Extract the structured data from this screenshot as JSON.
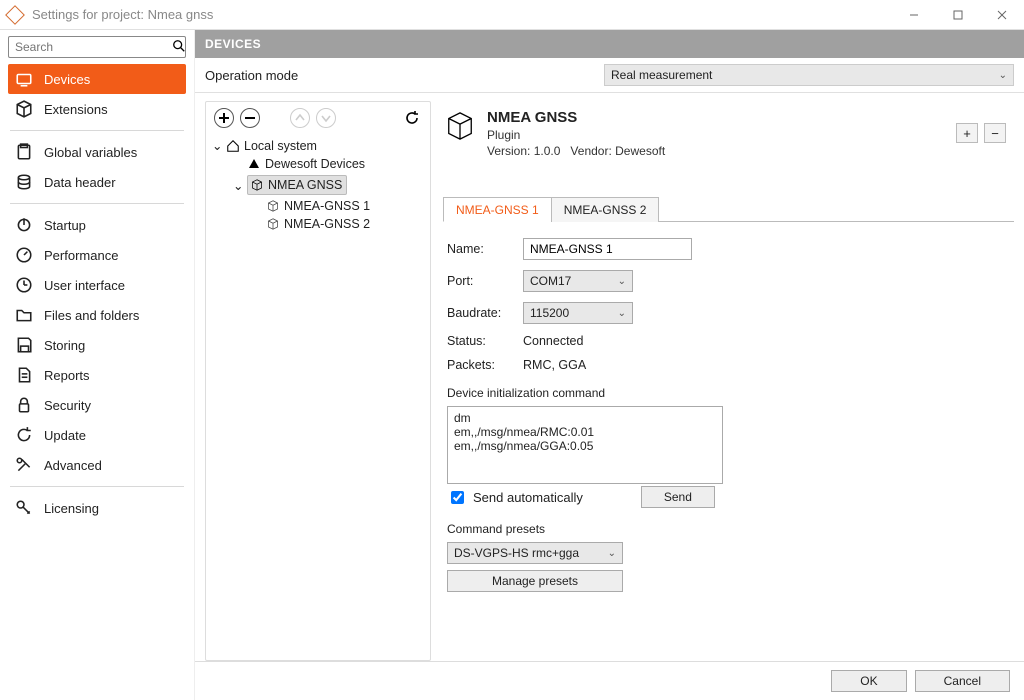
{
  "window": {
    "title": "Settings for project: Nmea gnss"
  },
  "search": {
    "placeholder": "Search"
  },
  "sidebar": {
    "groups": [
      {
        "items": [
          {
            "id": "devices",
            "label": "Devices",
            "icon": "devices",
            "active": true
          },
          {
            "id": "extensions",
            "label": "Extensions",
            "icon": "cube"
          }
        ]
      },
      {
        "items": [
          {
            "id": "global-vars",
            "label": "Global variables",
            "icon": "clipboard"
          },
          {
            "id": "data-header",
            "label": "Data header",
            "icon": "database"
          }
        ]
      },
      {
        "items": [
          {
            "id": "startup",
            "label": "Startup",
            "icon": "power"
          },
          {
            "id": "performance",
            "label": "Performance",
            "icon": "gauge"
          },
          {
            "id": "ui",
            "label": "User interface",
            "icon": "clock"
          },
          {
            "id": "files",
            "label": "Files and folders",
            "icon": "folder"
          },
          {
            "id": "storing",
            "label": "Storing",
            "icon": "save"
          },
          {
            "id": "reports",
            "label": "Reports",
            "icon": "document"
          },
          {
            "id": "security",
            "label": "Security",
            "icon": "lock"
          },
          {
            "id": "update",
            "label": "Update",
            "icon": "refresh"
          },
          {
            "id": "advanced",
            "label": "Advanced",
            "icon": "tools"
          }
        ]
      },
      {
        "items": [
          {
            "id": "licensing",
            "label": "Licensing",
            "icon": "key"
          }
        ]
      }
    ]
  },
  "section_header": "DEVICES",
  "operation_mode": {
    "label": "Operation mode",
    "value": "Real measurement"
  },
  "tree": {
    "root": {
      "label": "Local system",
      "children": [
        {
          "id": "dewesoft-devices",
          "label": "Dewesoft Devices",
          "icon": "triangle"
        },
        {
          "id": "nmea-gnss",
          "label": "NMEA GNSS",
          "icon": "cube",
          "selected": true,
          "children": [
            {
              "id": "nmea1",
              "label": "NMEA-GNSS 1",
              "icon": "cube"
            },
            {
              "id": "nmea2",
              "label": "NMEA-GNSS 2",
              "icon": "cube"
            }
          ]
        }
      ]
    }
  },
  "device": {
    "title": "NMEA GNSS",
    "subtitle": "Plugin",
    "version_label": "Version:",
    "version": "1.0.0",
    "vendor_label": "Vendor:",
    "vendor": "Dewesoft",
    "tabs": [
      {
        "id": "t1",
        "label": "NMEA-GNSS 1",
        "active": true
      },
      {
        "id": "t2",
        "label": "NMEA-GNSS 2"
      }
    ],
    "fields": {
      "name_label": "Name:",
      "name_value": "NMEA-GNSS 1",
      "port_label": "Port:",
      "port_value": "COM17",
      "baudrate_label": "Baudrate:",
      "baudrate_value": "115200",
      "status_label": "Status:",
      "status_value": "Connected",
      "packets_label": "Packets:",
      "packets_value": "RMC, GGA"
    },
    "init_label": "Device initialization command",
    "init_text": "dm\nem,,/msg/nmea/RMC:0.01\nem,,/msg/nmea/GGA:0.05",
    "send_auto_label": "Send automatically",
    "send_button": "Send",
    "presets_label": "Command presets",
    "preset_value": "DS-VGPS-HS rmc+gga",
    "manage_presets": "Manage presets"
  },
  "footer": {
    "ok": "OK",
    "cancel": "Cancel"
  },
  "icons": {
    "plus": "+",
    "minus": "−",
    "chev": "⌄"
  }
}
